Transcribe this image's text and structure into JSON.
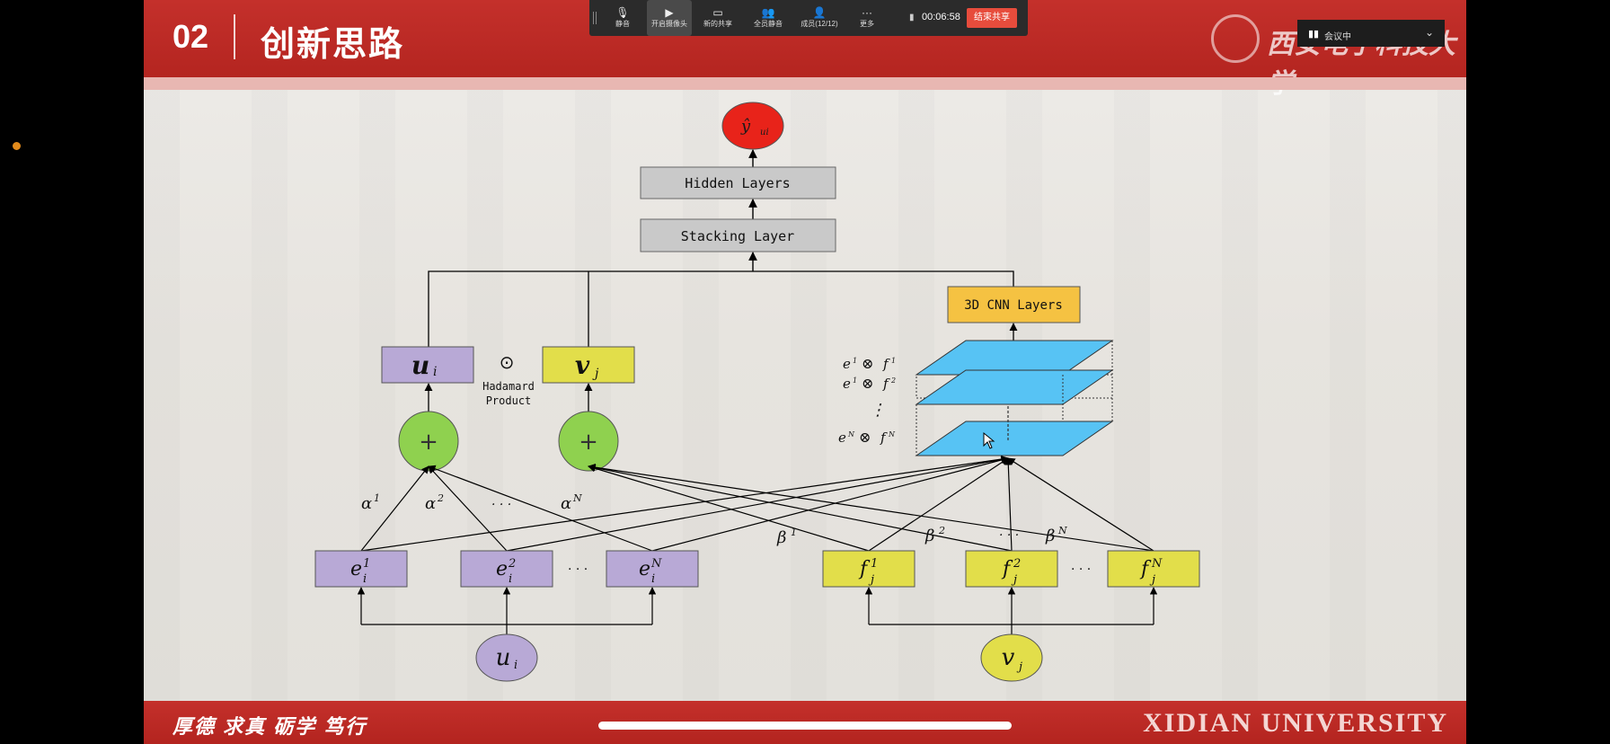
{
  "slide": {
    "number": "02",
    "title": "创新思路",
    "motto": "厚德  求真  砺学  笃行",
    "university": "XIDIAN UNIVERSITY"
  },
  "toolbar": {
    "items": [
      "静音",
      "开启摄像头",
      "新的共享",
      "全员静音",
      "成员(12/12)",
      "更多"
    ],
    "timer": "00:06:58",
    "end_share": "结束共享"
  },
  "meeting_status": {
    "label": "会议中"
  },
  "diagram": {
    "output_node": "ŷ",
    "output_sub": "ui",
    "hidden_layers": "Hidden Layers",
    "stacking_layer": "Stacking Layer",
    "cnn_layers": "3D CNN Layers",
    "u_label": "u",
    "u_sub": "i",
    "v_label": "v",
    "v_sub": "j",
    "hadamard_symbol": "⊙",
    "hadamard_line1": "Hadamard",
    "hadamard_line2": "Product",
    "plus": "+",
    "alpha_1": "α",
    "alpha_1_sup": "1",
    "alpha_2": "α",
    "alpha_2_sup": "2",
    "alpha_N": "α",
    "alpha_N_sup": "N",
    "beta_1": "β",
    "beta_1_sup": "1",
    "beta_2": "β",
    "beta_2_sup": "2",
    "beta_N": "β",
    "beta_N_sup": "N",
    "dots": "· · ·",
    "e_base": "e",
    "e_sub": "i",
    "e_sups": [
      "1",
      "2",
      "N"
    ],
    "f_base": "f",
    "f_sub": "j",
    "f_sups": [
      "1",
      "2",
      "N"
    ],
    "u_bottom": "u",
    "u_bottom_sub": "i",
    "v_bottom": "v",
    "v_bottom_sub": "j",
    "kron_sym": "⊗",
    "kron_sups": [
      "1",
      "2",
      "N"
    ],
    "vdots": "⋮"
  },
  "colors": {
    "header_red": "#c4302b",
    "purple_box": "#b8a9d6",
    "yellow_box": "#e2de4a",
    "green_node": "#8fd14f",
    "red_node": "#e8231a",
    "orange_box": "#f5c242",
    "cube_blue": "#57c3f4",
    "grey_box": "#c9c9c9"
  }
}
